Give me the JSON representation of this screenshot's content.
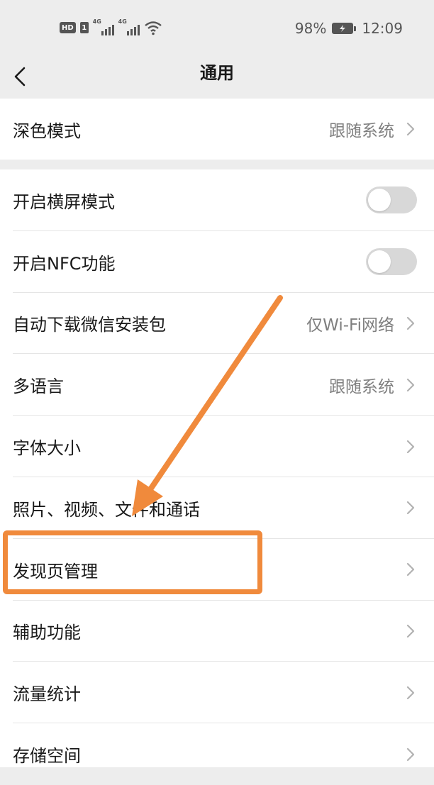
{
  "status_bar": {
    "hd_badge": "HD",
    "sim_badge": "1",
    "network_1": "4G",
    "network_2": "4G",
    "battery_percent": "98%",
    "time": "12:09",
    "icons": [
      "hd-icon",
      "signal-icon",
      "signal-icon",
      "wifi-icon",
      "battery-charging-icon"
    ]
  },
  "nav": {
    "title": "通用",
    "back_icon": "chevron-left-icon"
  },
  "settings": {
    "dark_mode": {
      "label": "深色模式",
      "value": "跟随系统"
    },
    "items": [
      {
        "label": "开启横屏模式",
        "toggle": false
      },
      {
        "label": "开启NFC功能",
        "toggle": false
      },
      {
        "label": "自动下载微信安装包",
        "value": "仅Wi-Fi网络"
      },
      {
        "label": "多语言",
        "value": "跟随系统"
      },
      {
        "label": "字体大小",
        "value": ""
      },
      {
        "label": "照片、视频、文件和通话",
        "value": ""
      },
      {
        "label": "发现页管理",
        "value": ""
      },
      {
        "label": "辅助功能",
        "value": ""
      },
      {
        "label": "流量统计",
        "value": ""
      },
      {
        "label": "存储空间",
        "value": ""
      }
    ]
  },
  "annotation": {
    "color": "#f08a3c",
    "target": "发现页管理"
  }
}
